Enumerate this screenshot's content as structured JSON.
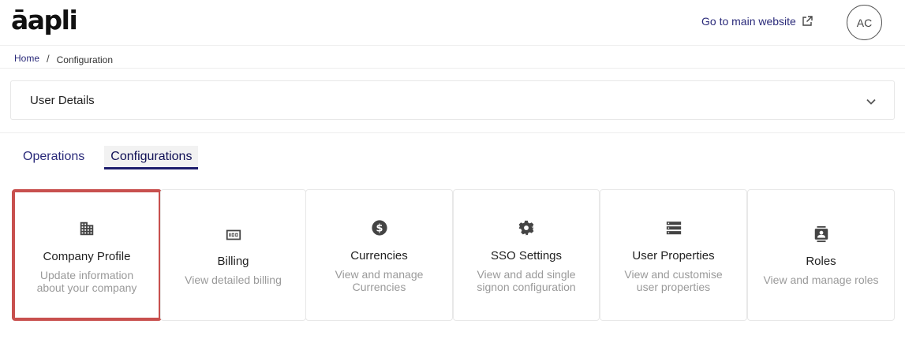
{
  "header": {
    "logo": "āapli",
    "main_link": "Go to main website",
    "avatar": "AC"
  },
  "breadcrumb": {
    "home": "Home",
    "separator": "/",
    "current": "Configuration"
  },
  "accordion": {
    "title": "User Details"
  },
  "tabs": [
    {
      "label": "Operations",
      "active": false
    },
    {
      "label": "Configurations",
      "active": true
    }
  ],
  "cards": [
    {
      "icon": "building-icon",
      "title": "Company Profile",
      "desc1": "Update information",
      "desc2": "about your company",
      "selected": true
    },
    {
      "icon": "billing-icon",
      "title": "Billing",
      "desc1": "View detailed billing",
      "desc2": ""
    },
    {
      "icon": "dollar-icon",
      "title": "Currencies",
      "desc1": "View and manage",
      "desc2": "Currencies"
    },
    {
      "icon": "gear-icon",
      "title": "SSO Settings",
      "desc1": "View and add single",
      "desc2": "signon configuration"
    },
    {
      "icon": "list-icon",
      "title": "User Properties",
      "desc1": "View and customise",
      "desc2": "user properties"
    },
    {
      "icon": "contact-icon",
      "title": "Roles",
      "desc1": "View and manage roles",
      "desc2": ""
    }
  ],
  "colors": {
    "accent": "#2a2a7a",
    "selected_border": "#c8504e"
  }
}
